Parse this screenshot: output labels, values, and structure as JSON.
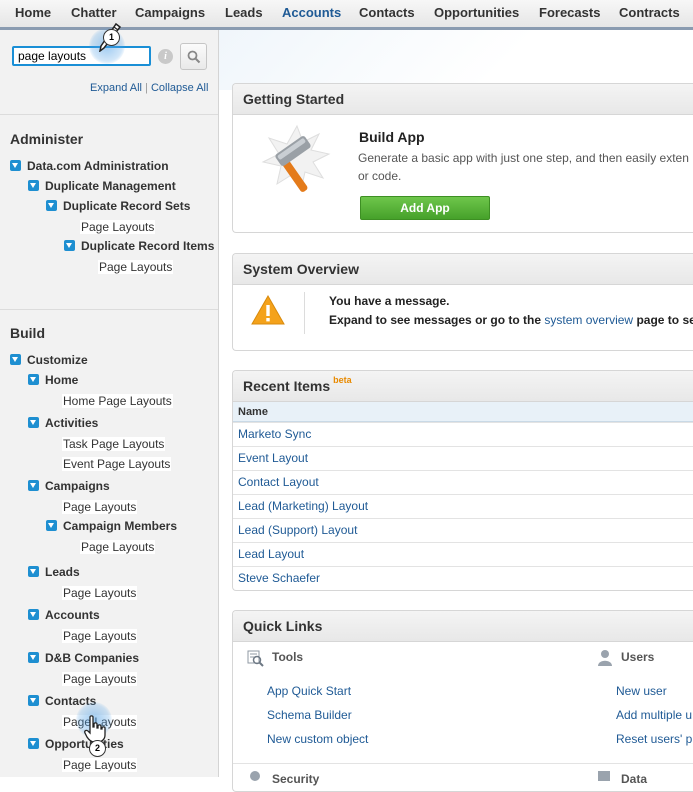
{
  "nav": {
    "tabs": [
      "Home",
      "Chatter",
      "Campaigns",
      "Leads",
      "Accounts",
      "Contacts",
      "Opportunities",
      "Forecasts",
      "Contracts"
    ],
    "active_tab": "Accounts"
  },
  "sidebar": {
    "search_value": "page layouts",
    "expand_all": "Expand All",
    "separator": "|",
    "collapse_all": "Collapse All",
    "administer": {
      "title": "Administer",
      "datacom": "Data.com Administration",
      "duplicate_management": "Duplicate Management",
      "duplicate_record_sets": "Duplicate Record Sets",
      "drs_page_layouts": "Page Layouts",
      "duplicate_record_items": "Duplicate Record Items",
      "dri_page_layouts": "Page Layouts"
    },
    "build": {
      "title": "Build",
      "customize": "Customize",
      "home": "Home",
      "home_page_layouts": "Home Page Layouts",
      "activities": "Activities",
      "task_page_layouts": "Task Page Layouts",
      "event_page_layouts": "Event Page Layouts",
      "campaigns": "Campaigns",
      "campaigns_page_layouts": "Page Layouts",
      "campaign_members": "Campaign Members",
      "campaign_members_page_layouts": "Page Layouts",
      "leads": "Leads",
      "leads_page_layouts": "Page Layouts",
      "accounts": "Accounts",
      "accounts_page_layouts": "Page Layouts",
      "dnb_companies": "D&B Companies",
      "dnb_page_layouts": "Page Layouts",
      "contacts": "Contacts",
      "contacts_page_layouts": "Page Layouts",
      "opportunities": "Opportunities",
      "opportunities_page_layouts": "Page Layouts"
    }
  },
  "getting_started": {
    "title": "Getting Started",
    "build_app_title": "Build App",
    "desc_line1": "Generate a basic app with just one step, and then easily exten",
    "desc_line2": "or code.",
    "add_app_button": "Add App"
  },
  "system_overview": {
    "title": "System Overview",
    "message": "You have a message.",
    "line2_prefix": "Expand to see messages or go to the",
    "link": "system overview",
    "line2_suffix": "page to se"
  },
  "recent_items": {
    "title": "Recent Items",
    "badge": "beta",
    "column_name": "Name",
    "rows": [
      "Marketo Sync",
      "Event Layout",
      "Contact Layout",
      "Lead (Marketing) Layout",
      "Lead (Support) Layout",
      "Lead Layout",
      "Steve Schaefer"
    ]
  },
  "quick_links": {
    "title": "Quick Links",
    "tools_title": "Tools",
    "tools": [
      "App Quick Start",
      "Schema Builder",
      "New custom object"
    ],
    "users_title": "Users",
    "users": [
      "New user",
      "Add multiple u",
      "Reset users' p"
    ],
    "security_title": "Security",
    "data_title": "Data"
  },
  "steps": [
    "1",
    "2"
  ],
  "colors": {
    "accent": "#1f5a95",
    "tree_toggle": "#1e8fd1",
    "add_app": "#46a12a",
    "beta": "#e88a00"
  }
}
